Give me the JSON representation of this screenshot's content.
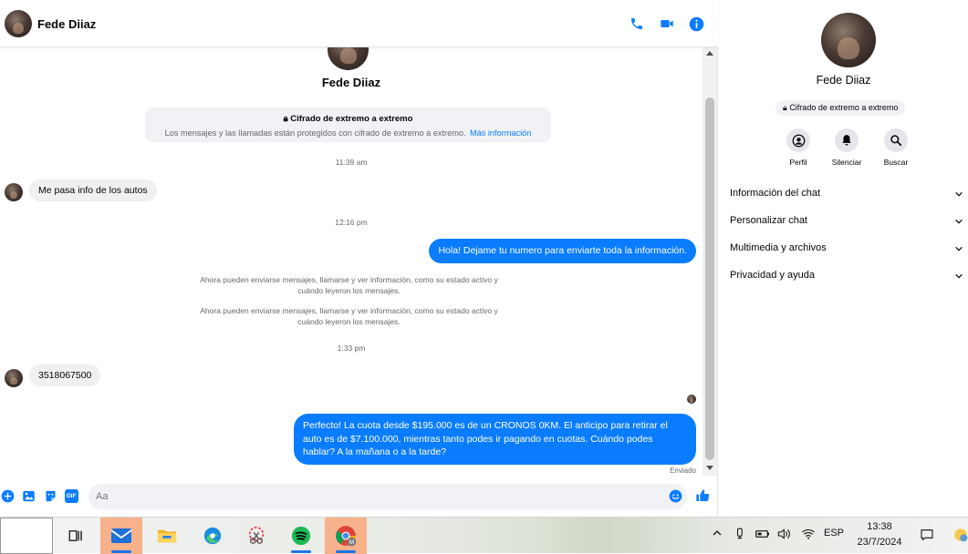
{
  "contact": {
    "name": "Fede Diiaz"
  },
  "header": {
    "call_icon": "phone-icon",
    "video_icon": "video-icon",
    "info_icon": "info-icon"
  },
  "encryption": {
    "title": "Cifrado de extremo a extremo",
    "description": "Los mensajes y las llamadas están protegidos con cifrado de extremo a extremo.",
    "link": "Más información"
  },
  "messages": [
    {
      "type": "timestamp",
      "text": "11:39 am"
    },
    {
      "type": "incoming",
      "text": "Me pasa info de los autos"
    },
    {
      "type": "timestamp",
      "text": "12:16 pm"
    },
    {
      "type": "outgoing",
      "text": "Hola! Dejame tu numero  para enviarte toda la información."
    },
    {
      "type": "system",
      "text": "Ahora pueden enviarse mensajes, llamarse y ver información, como su estado activo y cuándo leyeron los mensajes."
    },
    {
      "type": "system",
      "text": "Ahora pueden enviarse mensajes, llamarse y ver información, como su estado activo y cuándo leyeron los mensajes."
    },
    {
      "type": "timestamp",
      "text": "1:33 pm"
    },
    {
      "type": "incoming",
      "text": "3518067500"
    },
    {
      "type": "outgoing",
      "text": "Perfecto! La cuota desde $195.000 es de un CRONOS 0KM. El anticipo para retirar el auto es de $7.100.000, mientras tanto podes ir pagando en cuotas. Cuándo podes hablar? A la mañana o a la tarde?"
    }
  ],
  "sent_status": "Enviado",
  "composer": {
    "placeholder": "Aa",
    "icons": [
      "plus-icon",
      "image-icon",
      "sticker-icon",
      "gif-icon",
      "emoji-icon",
      "like-icon"
    ],
    "gif_label": "GIF"
  },
  "info_panel": {
    "name": "Fede Diiaz",
    "e2e_badge": "Cifrado de extremo a extremo",
    "actions": [
      {
        "label": "Perfil",
        "icon": "profile-icon"
      },
      {
        "label": "Silenciar",
        "icon": "bell-icon"
      },
      {
        "label": "Buscar",
        "icon": "search-icon"
      }
    ],
    "sections": [
      "Información del chat",
      "Personalizar chat",
      "Multimedia y archivos",
      "Privacidad y ayuda"
    ]
  },
  "taskbar": {
    "apps": [
      "task-view-icon",
      "mail-icon",
      "file-explorer-icon",
      "edge-icon",
      "snipping-tool-icon",
      "spotify-icon",
      "chrome-icon"
    ],
    "language": "ESP",
    "time": "13:38",
    "date": "23/7/2024"
  },
  "colors": {
    "accent": "#0a7cff",
    "incoming_bubble": "#f0f0f0",
    "panel_bg": "#f0f2f5"
  }
}
